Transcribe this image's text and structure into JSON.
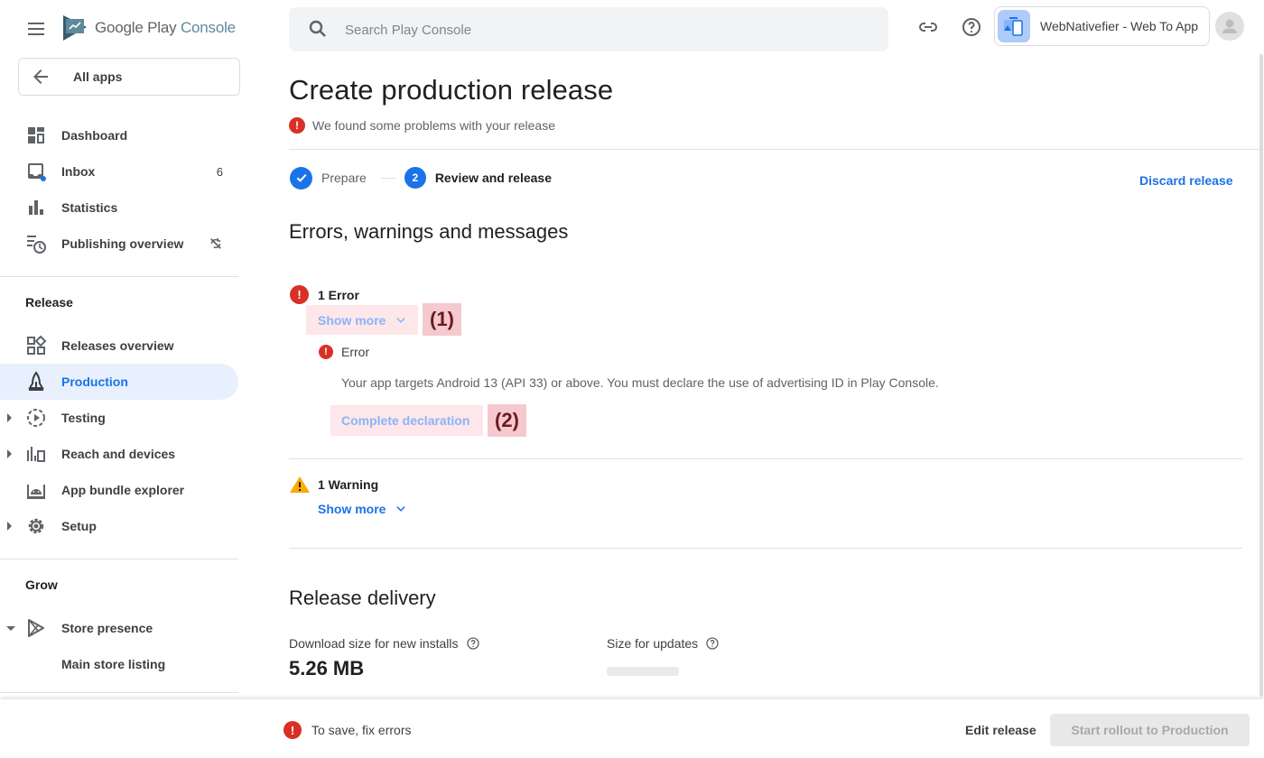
{
  "brand": {
    "name_prefix": "Google Play",
    "name_suffix": "Console"
  },
  "sidebar": {
    "all_apps": "All apps",
    "top_items": [
      {
        "label": "Dashboard",
        "icon": "dashboard-icon"
      },
      {
        "label": "Inbox",
        "icon": "inbox-icon",
        "badge": "6"
      },
      {
        "label": "Statistics",
        "icon": "bar-chart-icon"
      },
      {
        "label": "Publishing overview",
        "icon": "publishing-overview-icon",
        "trail_icon": "sync-disabled-icon"
      }
    ],
    "release_section": {
      "title": "Release",
      "items": [
        {
          "label": "Releases overview",
          "icon": "releases-overview-icon"
        },
        {
          "label": "Production",
          "icon": "production-icon",
          "active": true
        },
        {
          "label": "Testing",
          "icon": "testing-icon",
          "expandable": true
        },
        {
          "label": "Reach and devices",
          "icon": "reach-devices-icon",
          "expandable": true
        },
        {
          "label": "App bundle explorer",
          "icon": "android-icon"
        },
        {
          "label": "Setup",
          "icon": "gear-icon",
          "expandable": true
        }
      ]
    },
    "grow_section": {
      "title": "Grow",
      "items": [
        {
          "label": "Store presence",
          "icon": "play-store-icon",
          "expanded": true
        },
        {
          "label": "Main store listing",
          "sub": true
        }
      ]
    }
  },
  "topbar": {
    "search_placeholder": "Search Play Console",
    "search_value": "",
    "app_name": "WebNativefier - Web To App"
  },
  "main": {
    "title": "Create production release",
    "problem_text": "We found some problems with your release",
    "steps": [
      {
        "label": "Prepare",
        "state": "done"
      },
      {
        "number": "2",
        "label": "Review and release",
        "state": "current"
      }
    ],
    "discard_label": "Discard release",
    "messages_heading": "Errors, warnings and messages",
    "errors": {
      "heading": "1 Error",
      "show_more": "Show more",
      "marker": "(1)",
      "item_title": "Error",
      "item_message": "Your app targets Android 13 (API 33) or above. You must declare the use of advertising ID in Play Console.",
      "action_label": "Complete declaration",
      "action_marker": "(2)"
    },
    "warnings": {
      "heading": "1 Warning",
      "show_more": "Show more"
    },
    "delivery": {
      "heading": "Release delivery",
      "download_label": "Download size for new installs",
      "download_value": "5.26 MB",
      "updates_label": "Size for updates",
      "updates_value": null
    }
  },
  "footer": {
    "error_text": "To save, fix errors",
    "edit_label": "Edit release",
    "rollout_label": "Start rollout to Production"
  },
  "colors": {
    "accent": "#1a73e8",
    "error": "#d93025",
    "warning": "#f9ab00",
    "highlight": "#fde7ea",
    "marker": "#f5c9cf"
  }
}
